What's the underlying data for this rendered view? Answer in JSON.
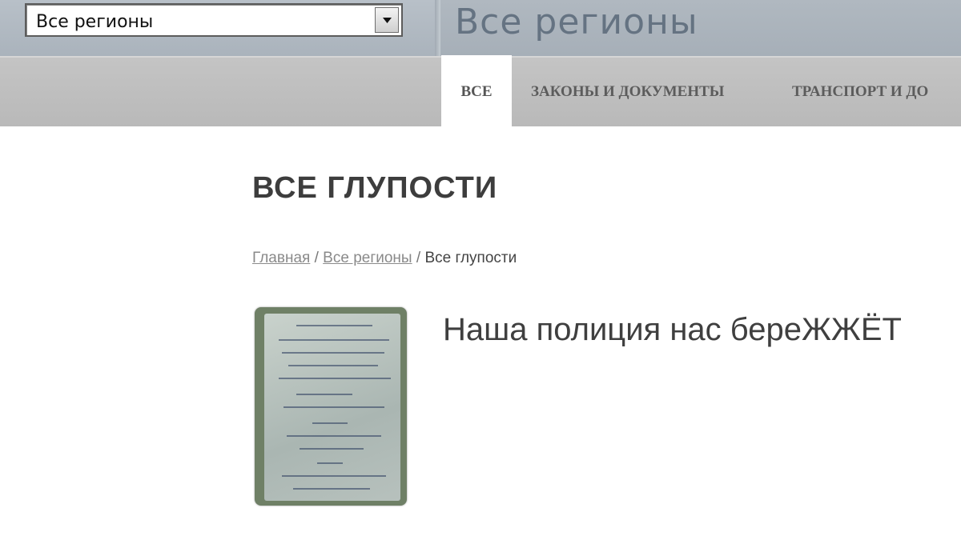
{
  "header": {
    "region_select": {
      "value": "Все регионы"
    },
    "region_title": "Все регионы"
  },
  "nav": {
    "tabs": [
      {
        "label": "ВСЕ",
        "active": true
      },
      {
        "label": "ЗАКОНЫ И ДОКУМЕНТЫ",
        "active": false
      },
      {
        "label": "ТРАНСПОРТ И ДО",
        "active": false
      }
    ]
  },
  "main": {
    "page_title": "ВСЕ ГЛУПОСТИ",
    "breadcrumb": {
      "home": "Главная",
      "separator": " / ",
      "regions": "Все регионы",
      "current": "Все глупости"
    },
    "post": {
      "title": "Наша полиция нас береЖЖЁТ"
    }
  },
  "colors": {
    "header_bg": "#aab3bc",
    "nav_bg": "#bebebe",
    "title_text": "#3d3d3d",
    "region_title_text": "#657382"
  }
}
